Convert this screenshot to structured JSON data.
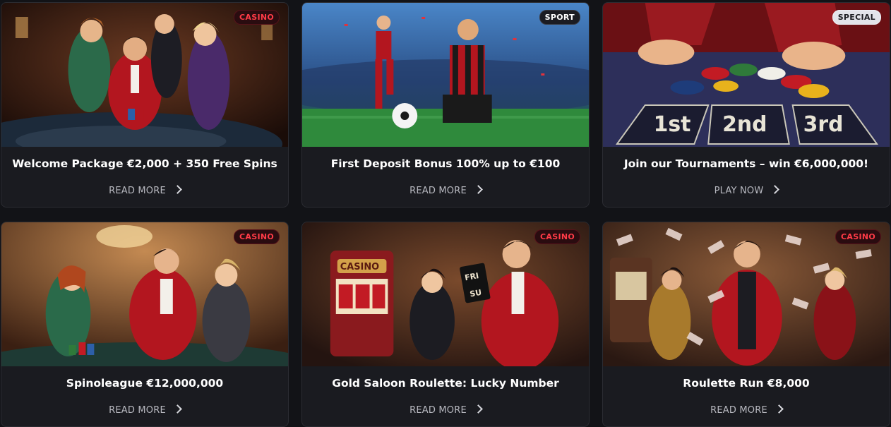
{
  "promotions": [
    {
      "badge": "CASINO",
      "badge_style": "casino",
      "title": "Welcome Package €2,000 + 350 Free Spins",
      "cta": "READ MORE",
      "image": "casino-party-illustration"
    },
    {
      "badge": "SPORT",
      "badge_style": "sport",
      "title": "First Deposit Bonus 100% up to €100",
      "cta": "READ MORE",
      "image": "football-stadium-illustration"
    },
    {
      "badge": "SPECIAL",
      "badge_style": "special",
      "title": "Join our Tournaments – win €6,000,000!",
      "cta": "PLAY NOW",
      "image": "roulette-chips-illustration"
    },
    {
      "badge": "CASINO",
      "badge_style": "casino",
      "title": "Spinoleague €12,000,000",
      "cta": "READ MORE",
      "image": "casino-table-illustration"
    },
    {
      "badge": "CASINO",
      "badge_style": "casino",
      "title": "Gold Saloon Roulette: Lucky Number",
      "cta": "READ MORE",
      "image": "slot-machine-illustration"
    },
    {
      "badge": "CASINO",
      "badge_style": "casino",
      "title": "Roulette Run €8,000",
      "cta": "READ MORE",
      "image": "money-rain-illustration"
    }
  ],
  "image_texts": {
    "slot_sign": "CASINO",
    "fri_card_top": "FRI",
    "fri_card_bottom": "SU",
    "bet_1": "1st",
    "bet_2": "2nd",
    "bet_3": "3rd"
  },
  "colors": {
    "page_bg": "#121317",
    "card_bg": "#1a1b20",
    "casino_badge": "#ff3b47",
    "accent_red": "#b3161f"
  }
}
